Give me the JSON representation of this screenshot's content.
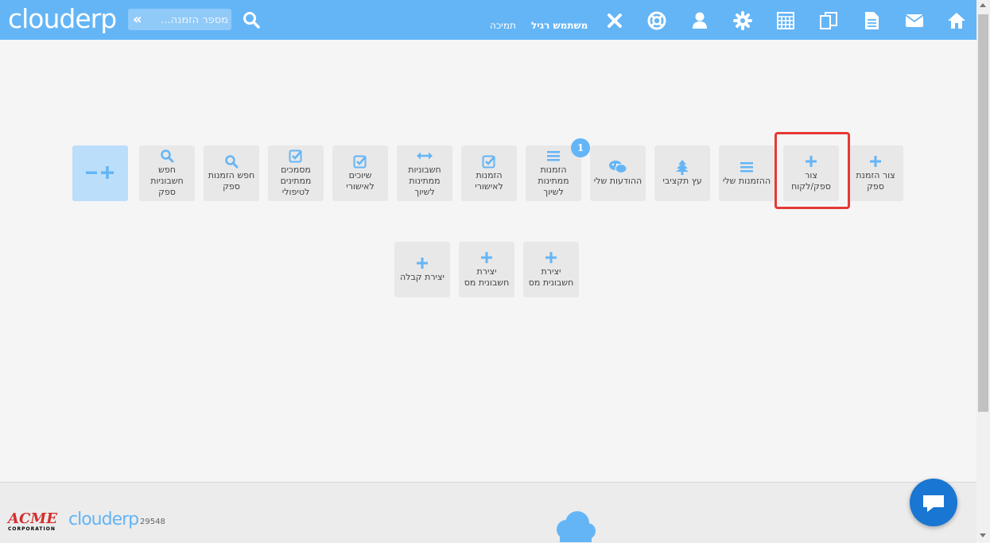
{
  "header": {
    "logo": "clouderp",
    "search_placeholder": "מספר הזמנה...",
    "user_name": "משתמש רגיל",
    "support": "תמיכה",
    "nav_icons": [
      "home-icon",
      "envelope-icon",
      "document-icon",
      "copy-icon",
      "calculator-icon",
      "gear-icon",
      "user-icon",
      "lifebuoy-icon",
      "close-icon"
    ]
  },
  "tiles_row1": [
    {
      "label": "צור הזמנת ספק",
      "icon": "plus-icon"
    },
    {
      "label": "צור ספק/לקוח",
      "icon": "plus-icon"
    },
    {
      "label": "ההזמנות שלי",
      "icon": "list-icon"
    },
    {
      "label": "עץ תקציבי",
      "icon": "tree-icon"
    },
    {
      "label": "ההודעות שלי",
      "icon": "chat-icon"
    },
    {
      "label": "הזמנות ממתינות לשיוך",
      "icon": "list-icon",
      "badge": "1"
    },
    {
      "label": "הזמנות לאישורי",
      "icon": "check-icon"
    },
    {
      "label": "חשבוניות ממתינות לשיוך",
      "icon": "arrows-icon"
    },
    {
      "label": "שיוכים לאישורי",
      "icon": "check-icon"
    },
    {
      "label": "מסמכים ממתינים לטיפולי",
      "icon": "check-icon"
    },
    {
      "label": "חפש הזמנות ספק",
      "icon": "search-icon"
    },
    {
      "label": "חפש חשבוניות ספק",
      "icon": "search-icon"
    }
  ],
  "tiles_row2": [
    {
      "label": "יצירת חשבונית מס",
      "icon": "plus-icon"
    },
    {
      "label": "יצירת חשבונית מס",
      "icon": "plus-icon"
    },
    {
      "label": "יצירת קבלה",
      "icon": "plus-icon"
    }
  ],
  "zoom_control": "−+",
  "footer": {
    "acme": "ACME",
    "acme_sub": "CORPORATION",
    "logo": "clouderp",
    "number": "29548"
  },
  "colors": {
    "topbar": "#64b5f6",
    "highlight": "#e53935",
    "chat": "#1976d2"
  }
}
